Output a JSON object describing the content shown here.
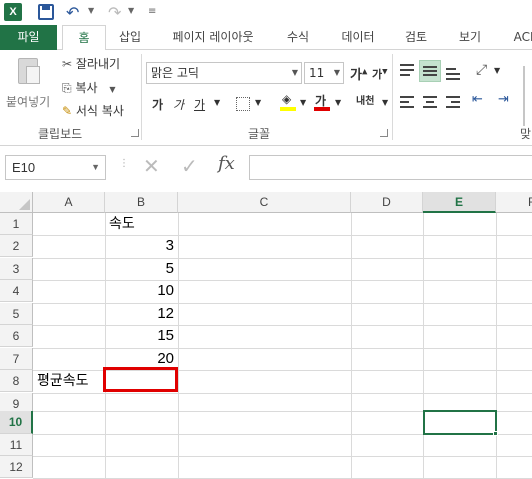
{
  "qat": {
    "app_icon": "X",
    "undo_icon": "undo-icon",
    "redo_icon": "redo-icon"
  },
  "tabs": [
    "파일",
    "홈",
    "삽입",
    "페이지 레이아웃",
    "수식",
    "데이터",
    "검토",
    "보기",
    "ACR"
  ],
  "ribbon": {
    "clipboard": {
      "paste": "붙여넣기",
      "cut": "잘라내기",
      "copy": "복사",
      "format_painter": "서식 복사",
      "label": "클립보드"
    },
    "font": {
      "name": "맑은 고딕",
      "size": "11",
      "grow": "가",
      "shrink": "가",
      "bold": "가",
      "italic": "가",
      "underline": "가",
      "font_color": "가",
      "label": "글꼴"
    },
    "alignment": {
      "label": "맞",
      "wrap": "내천"
    }
  },
  "formula_bar": {
    "name_box": "E10",
    "fx": "fx",
    "value": ""
  },
  "columns": [
    "A",
    "B",
    "C",
    "D",
    "E",
    "F"
  ],
  "rows": [
    "1",
    "2",
    "3",
    "4",
    "5",
    "6",
    "7",
    "8",
    "9",
    "10",
    "11",
    "12"
  ],
  "cells": {
    "B1": "속도",
    "B2": "3",
    "B3": "5",
    "B4": "10",
    "B5": "12",
    "B6": "15",
    "B7": "20",
    "A8": "평균속도"
  },
  "colors": {
    "accent": "#217346",
    "highlight_border": "#e00000"
  }
}
